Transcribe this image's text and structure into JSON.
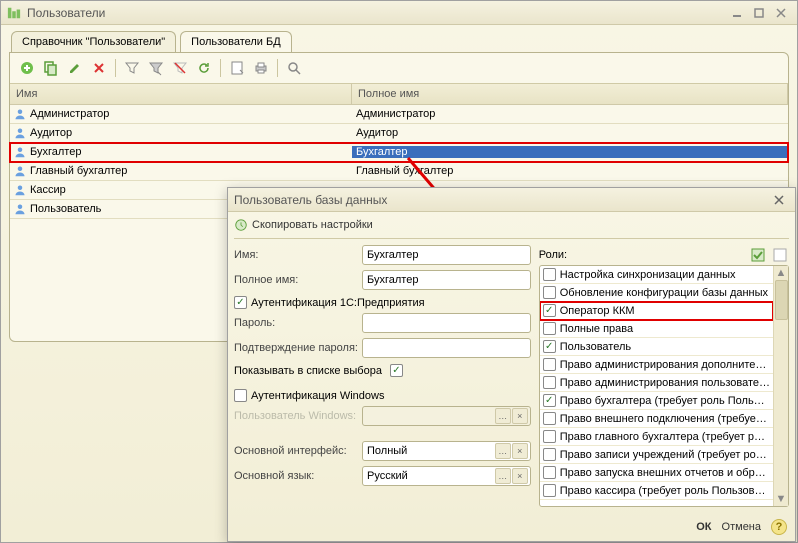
{
  "mainWindow": {
    "title": "Пользователи",
    "tabs": [
      {
        "label": "Справочник \"Пользователи\""
      },
      {
        "label": "Пользователи БД"
      }
    ],
    "activeTab": 1,
    "columns": {
      "name": "Имя",
      "full": "Полное имя"
    },
    "rows": [
      {
        "name": "Администратор",
        "full": "Администратор"
      },
      {
        "name": "Аудитор",
        "full": "Аудитор"
      },
      {
        "name": "Бухгалтер",
        "full": "Бухгалтер",
        "selected": true
      },
      {
        "name": "Главный бухгалтер",
        "full": "Главный бухгалтер"
      },
      {
        "name": "Кассир",
        "full": ""
      },
      {
        "name": "Пользователь",
        "full": ""
      }
    ]
  },
  "dialog": {
    "title": "Пользователь базы данных",
    "copySettings": "Скопировать настройки",
    "labels": {
      "name": "Имя:",
      "fullName": "Полное имя:",
      "auth1c": "Аутентификация 1С:Предприятия",
      "password": "Пароль:",
      "passwordConfirm": "Подтверждение пароля:",
      "showInList": "Показывать в списке выбора",
      "authWin": "Аутентификация Windows",
      "winUser": "Пользователь Windows:",
      "mainInterface": "Основной интерфейс:",
      "mainLang": "Основной язык:",
      "roles": "Роли:"
    },
    "values": {
      "name": "Бухгалтер",
      "fullName": "Бухгалтер",
      "auth1cChecked": true,
      "showInListChecked": true,
      "authWinChecked": false,
      "mainInterface": "Полный",
      "mainLang": "Русский"
    },
    "roles": [
      {
        "label": "Настройка синхронизации данных",
        "checked": false
      },
      {
        "label": "Обновление конфигурации базы данных",
        "checked": false
      },
      {
        "label": "Оператор ККМ",
        "checked": true,
        "highlight": true
      },
      {
        "label": "Полные права",
        "checked": false
      },
      {
        "label": "Пользователь",
        "checked": true
      },
      {
        "label": "Право администрирования дополните…",
        "checked": false
      },
      {
        "label": "Право администрирования пользовате…",
        "checked": false
      },
      {
        "label": "Право бухгалтера (требует роль Поль…",
        "checked": true
      },
      {
        "label": "Право внешнего подключения (требуе…",
        "checked": false
      },
      {
        "label": "Право главного бухгалтера (требует р…",
        "checked": false
      },
      {
        "label": "Право записи учреждений (требует ро…",
        "checked": false
      },
      {
        "label": "Право запуска внешних отчетов и обр…",
        "checked": false
      },
      {
        "label": "Право кассира (требует роль Пользов…",
        "checked": false
      }
    ],
    "buttons": {
      "ok": "ОК",
      "cancel": "Отмена"
    }
  }
}
